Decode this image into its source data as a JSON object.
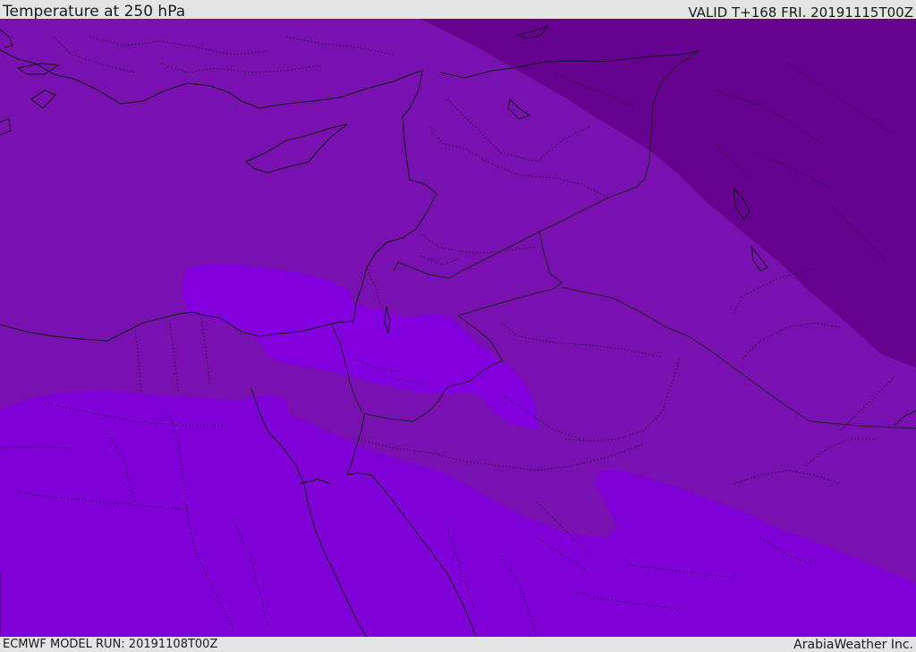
{
  "header": {
    "title": "Temperature at 250 hPa",
    "valid": "VALID T+168 FRI. 20191115T00Z"
  },
  "footer": {
    "model_run": "ECMWF MODEL RUN: 20191108T00Z",
    "brand": "ArabiaWeather Inc."
  },
  "map": {
    "variable": "temperature",
    "level": "250 hPa",
    "region": "Eastern Mediterranean / Middle East",
    "colors": {
      "band_mid": "#7811b0",
      "band_warm": "#8000d8",
      "band_bright_patch": "#8200e0",
      "band_cold_ne": "#64028f",
      "coastline": "#111111",
      "border": "#222222"
    }
  }
}
